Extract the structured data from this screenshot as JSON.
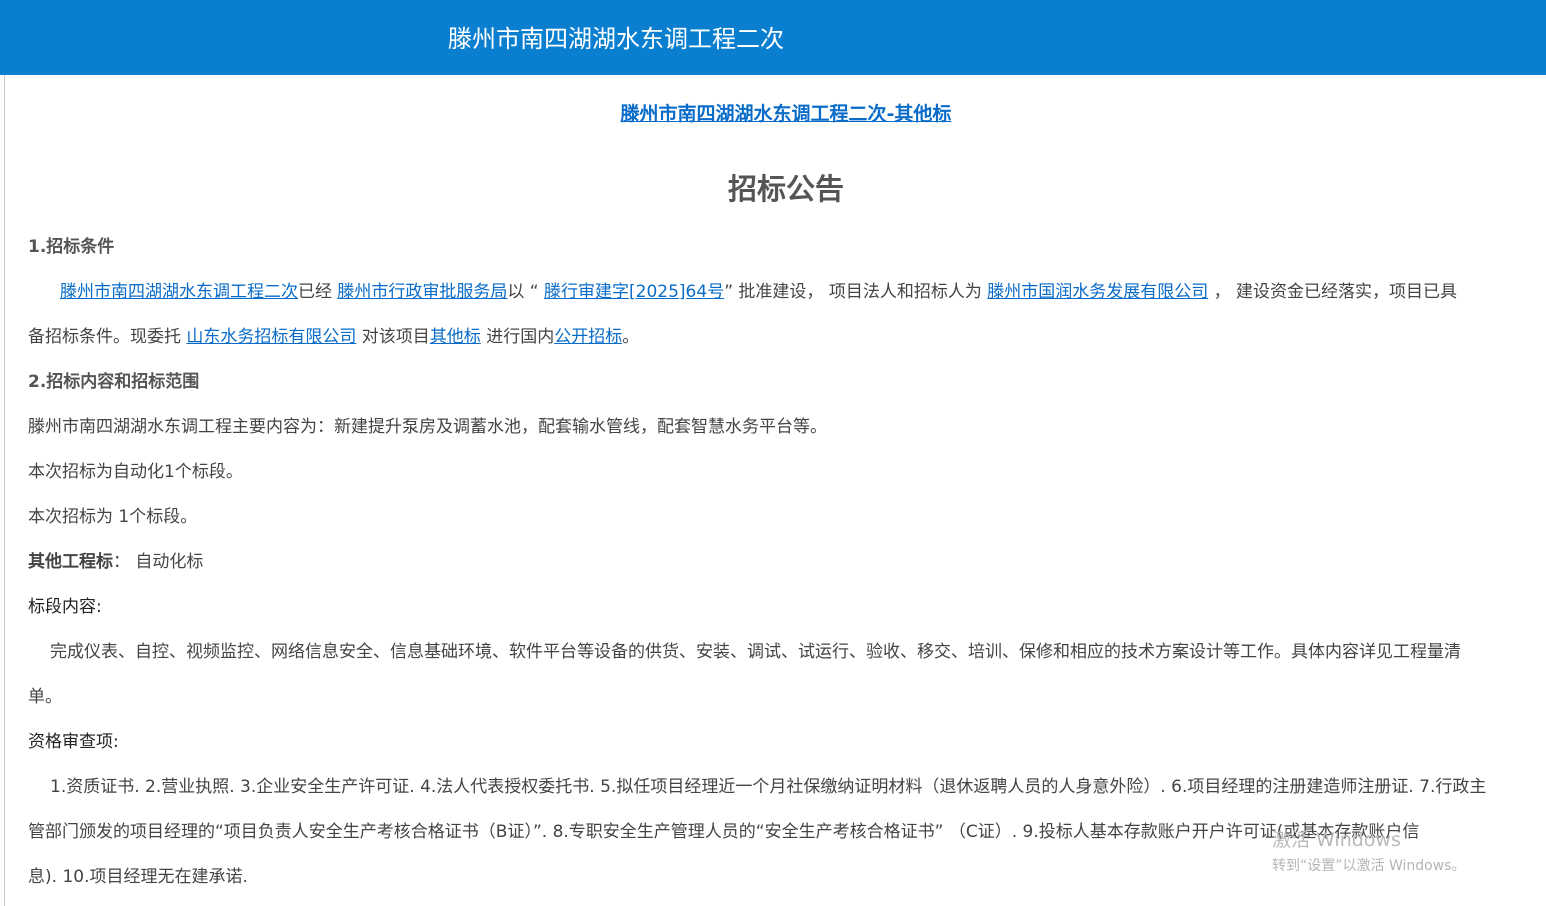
{
  "header": {
    "title": "滕州市南四湖湖水东调工程二次"
  },
  "project_link": "滕州市南四湖湖水东调工程二次-其他标",
  "page_title": "招标公告",
  "section1": {
    "heading": "1.招标条件",
    "l1": {
      "project": "滕州市南四湖湖水东调工程二次",
      "t1": "已经 ",
      "approver": "滕州市行政审批服务局",
      "t2": "以 “ ",
      "doc_no": "滕行审建字[2025]64号",
      "t3": "” 批准建设， 项目法人和招标人为 ",
      "owner": "滕州市国润水务发展有限公司",
      "t4": " ， 建设资金已经落实，项目已具"
    },
    "l2": {
      "t1": "备招标条件。现委托 ",
      "agency": "山东水务招标有限公司",
      "t2": " 对该项目",
      "section": "其他标",
      "t3": " 进行国内",
      "method": "公开招标",
      "t4": "。"
    }
  },
  "section2": {
    "heading": "2.招标内容和招标范围",
    "p1": "滕州市南四湖湖水东调工程主要内容为：新建提升泵房及调蓄水池，配套输水管线，配套智慧水务平台等。",
    "p2": "本次招标为自动化1个标段。",
    "p3": "本次招标为 1个标段。",
    "other_label": "其他工程标",
    "other_value": "：  自动化标",
    "scope_label": "标段内容:",
    "scope_l1": "完成仪表、自控、视频监控、网络信息安全、信息基础环境、软件平台等设备的供货、安装、调试、试运行、验收、移交、培训、保修和相应的技术方案设计等工作。具体内容详见工程量清",
    "scope_l2": "单。",
    "qual_label": "资格审查项:",
    "qual_l1": "1.资质证书. 2.营业执照. 3.企业安全生产许可证. 4.法人代表授权委托书. 5.拟任项目经理近一个月社保缴纳证明材料（退休返聘人员的人身意外险）. 6.项目经理的注册建造师注册证. 7.行政主",
    "qual_l2": "管部门颁发的项目经理的“项目负责人安全生产考核合格证书（B证）”. 8.专职安全生产管理人员的“安全生产考核合格证书” （C证）. 9.投标人基本存款账户开户许可证(或基本存款账户信",
    "qual_l3": "息). 10.项目经理无在建承诺."
  },
  "watermark": {
    "title": "激活 Windows",
    "subtitle": "转到“设置”以激活 Windows。"
  }
}
